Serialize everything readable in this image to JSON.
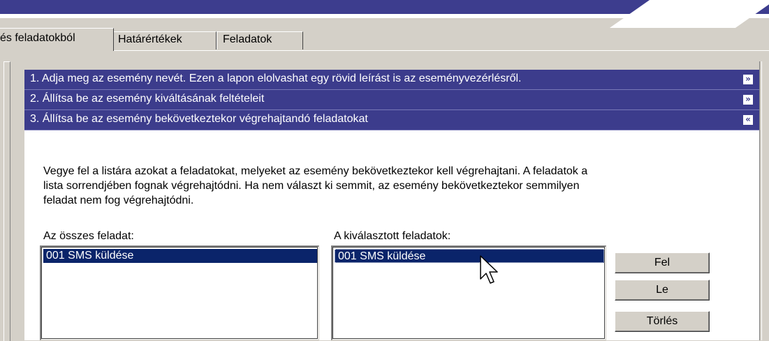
{
  "tabs": [
    {
      "label": "és feladatokból",
      "active": true
    },
    {
      "label": "Határértékek",
      "active": false
    },
    {
      "label": "Feladatok",
      "active": false
    }
  ],
  "steps": [
    {
      "label": "1. Adja meg az esemény nevét. Ezen a lapon elolvashat egy rövid leírást is az eseményvezérlésről.",
      "icon": "chevron-down-double-icon"
    },
    {
      "label": "2. Állítsa be az esemény kiváltásának feltételeit",
      "icon": "chevron-down-double-icon"
    },
    {
      "label": "3. Állítsa be az esemény bekövetkeztekor végrehajtandó feladatokat",
      "icon": "chevron-up-double-icon"
    }
  ],
  "description": {
    "line1": "Vegye fel a listára azokat a feladatokat, melyeket az esemény bekövetkeztekor kell végrehajtani. A feladatok a",
    "line2": "lista sorrendjében fognak végrehajtódni. Ha nem választ ki semmit, az esemény bekövetkeztekor semmilyen",
    "line3": "feladat nem fog végrehajtódni."
  },
  "all_tasks": {
    "label": "Az összes feladat:",
    "items": [
      "001 SMS küldése"
    ]
  },
  "selected_tasks": {
    "label": "A kiválasztott feladatok:",
    "items": [
      "001 SMS küldése"
    ]
  },
  "buttons": {
    "up": "Fel",
    "down": "Le",
    "delete": "Törlés"
  },
  "colors": {
    "header_bar": "#3c3c8c",
    "selection": "#0a246a",
    "window_bg": "#d4d0c8"
  }
}
